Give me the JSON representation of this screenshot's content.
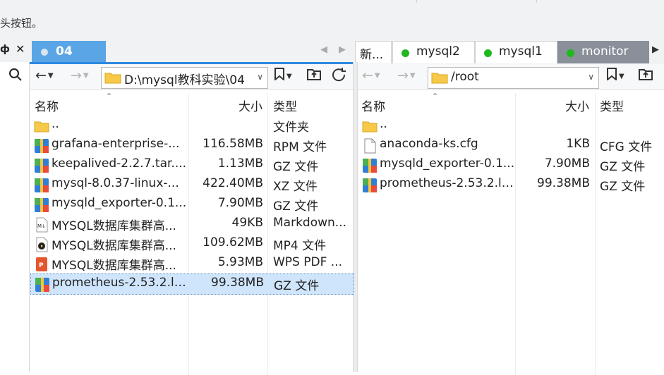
{
  "top_hint": "头按钮。",
  "sidebar": {
    "pin_glyph": "ф",
    "close_glyph": "✕"
  },
  "left_pane": {
    "tab_label": "04",
    "path": "D:\\mysql教科实验\\04",
    "columns": {
      "name": "名称",
      "size": "大小",
      "type": "类型"
    },
    "rows": [
      {
        "icon": "folder-icon",
        "name": "..",
        "size": "",
        "type": "文件夹"
      },
      {
        "icon": "archive-icon",
        "name": "grafana-enterprise-...",
        "size": "116.58MB",
        "type": "RPM 文件"
      },
      {
        "icon": "archive-icon",
        "name": "keepalived-2.2.7.tar....",
        "size": "1.13MB",
        "type": "GZ 文件"
      },
      {
        "icon": "archive-icon",
        "name": "mysql-8.0.37-linux-...",
        "size": "422.40MB",
        "type": "XZ 文件"
      },
      {
        "icon": "archive-icon",
        "name": "mysqld_exporter-0.1...",
        "size": "7.90MB",
        "type": "GZ 文件"
      },
      {
        "icon": "markdown-icon",
        "name": "MYSQL数据库集群高...",
        "size": "49KB",
        "type": "Markdown..."
      },
      {
        "icon": "video-icon",
        "name": "MYSQL数据库集群高...",
        "size": "109.62MB",
        "type": "MP4 文件"
      },
      {
        "icon": "pdf-icon",
        "name": "MYSQL数据库集群高...",
        "size": "5.93MB",
        "type": "WPS PDF ..."
      },
      {
        "icon": "archive-icon",
        "name": "prometheus-2.53.2.li...",
        "size": "99.38MB",
        "type": "GZ 文件",
        "selected": true
      }
    ]
  },
  "right_pane": {
    "tabs": [
      {
        "label": "新...",
        "dot": false,
        "active": false
      },
      {
        "label": "mysql2",
        "dot": true,
        "active": false
      },
      {
        "label": "mysql1",
        "dot": true,
        "active": false
      },
      {
        "label": "monitor",
        "dot": true,
        "active": true
      }
    ],
    "path": "/root",
    "columns": {
      "name": "名称",
      "size": "大小",
      "type": "类型"
    },
    "rows": [
      {
        "icon": "folder-icon",
        "name": "..",
        "size": "",
        "type": ""
      },
      {
        "icon": "file-icon",
        "name": "anaconda-ks.cfg",
        "size": "1KB",
        "type": "CFG 文件"
      },
      {
        "icon": "archive-icon",
        "name": "mysqld_exporter-0.1...",
        "size": "7.90MB",
        "type": "GZ 文件"
      },
      {
        "icon": "archive-icon",
        "name": "prometheus-2.53.2.li...",
        "size": "99.38MB",
        "type": "GZ 文件"
      }
    ]
  },
  "colors": {
    "accent_tab": "#5aa5e6",
    "active_remote_tab": "#8a9099",
    "online_dot": "#1fb81f",
    "selection": "#cfe5fb"
  }
}
